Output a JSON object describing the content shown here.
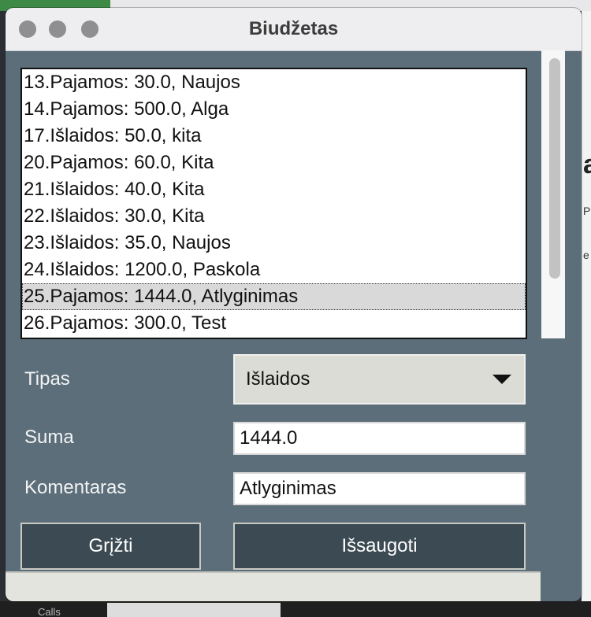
{
  "window": {
    "title": "Biudžetas"
  },
  "list": {
    "items": [
      "13.Pajamos: 30.0, Naujos",
      "14.Pajamos: 500.0, Alga",
      "17.Išlaidos: 50.0, kita",
      "20.Pajamos: 60.0, Kita",
      "21.Išlaidos: 40.0, Kita",
      "22.Išlaidos: 30.0, Kita",
      "23.Išlaidos: 35.0, Naujos",
      "24.Išlaidos: 1200.0, Paskola",
      "25.Pajamos: 1444.0, Atlyginimas",
      "26.Pajamos: 300.0, Test"
    ],
    "selected_index": 8
  },
  "form": {
    "type_label": "Tipas",
    "type_value": "Išlaidos",
    "amount_label": "Suma",
    "amount_value": "1444.0",
    "comment_label": "Komentaras",
    "comment_value": "Atlyginimas"
  },
  "buttons": {
    "back_label": "Grįžti",
    "save_label": "Išsaugoti"
  },
  "background": {
    "bottom_text": "Calls"
  },
  "colors": {
    "window_bg": "#5b6e7a",
    "button_bg": "#3c4a53",
    "selection_bg": "#d9d9d9"
  }
}
